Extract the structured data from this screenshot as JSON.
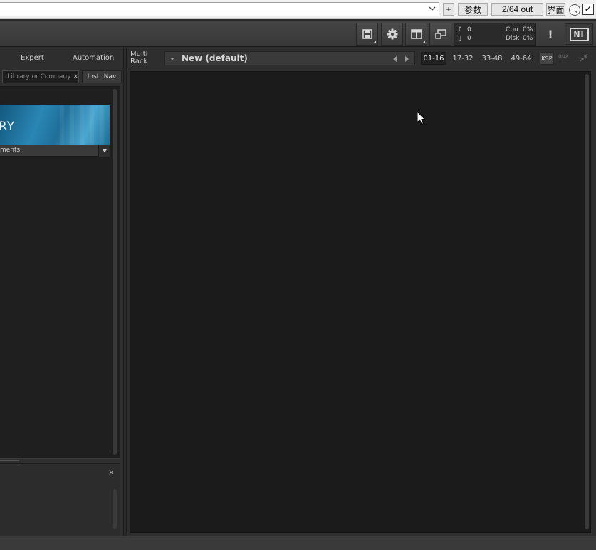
{
  "host": {
    "plus_label": "+",
    "params_label": "参数",
    "io_label": "2/64 out",
    "ui_label": "界面",
    "check_mark": "✓"
  },
  "header": {
    "icons": [
      "save-icon",
      "gear-icon",
      "view-layout-icon",
      "resize-icon"
    ],
    "meters": {
      "midi_label": "♪",
      "midi_value": "0",
      "disk_icon": "▯",
      "voices_value": "0",
      "cpu_label": "Cpu",
      "cpu_value": "0%",
      "disk_label": "Disk",
      "disk_value": "0%"
    },
    "alert": "!",
    "logo": "NI"
  },
  "browser": {
    "tabs": [
      "Expert",
      "Automation"
    ],
    "search_placeholder": "Library or Company",
    "search_clear": "×",
    "instr_nav_label": "Instr Nav",
    "library_banner_text": "RY",
    "library_dropdown_label": "ments",
    "info_close": "×"
  },
  "rack": {
    "label_line1": "Multi",
    "label_line2": "Rack",
    "preset_name": "New (default)",
    "pages": [
      "01-16",
      "17-32",
      "33-48",
      "49-64"
    ],
    "active_page": "01-16",
    "ksp_label": "KSP",
    "aux_label": "aux"
  },
  "colors": {
    "background": "#2b2b2b",
    "rack_body": "#1b1b1b",
    "banner_blue": "#2a86b4",
    "host_bar": "#f0f0f0"
  }
}
